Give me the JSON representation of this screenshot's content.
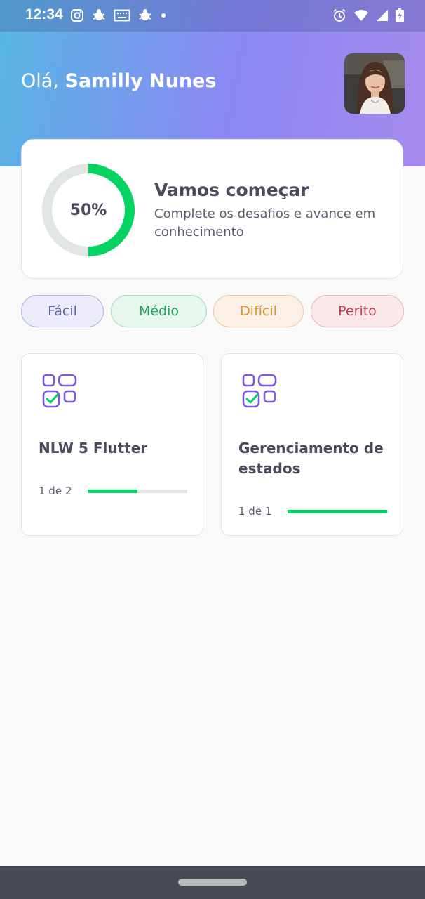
{
  "status_bar": {
    "time": "12:34",
    "left_icons": [
      "instagram-icon",
      "bug-icon",
      "keyboard-icon",
      "bug-icon",
      "dot-icon"
    ],
    "right_icons": [
      "alarm-icon",
      "wifi-icon",
      "signal-icon",
      "battery-charging-icon"
    ]
  },
  "header": {
    "greeting_prefix": "Olá, ",
    "user_name": "Samilly Nunes",
    "gradient_colors": [
      "#57B6E5",
      "#A68AED"
    ]
  },
  "score_card": {
    "percent": 50,
    "percent_label": "50%",
    "title": "Vamos começar",
    "subtitle": "Complete os desafios e avance em conhecimento",
    "ring_color": "#04D361",
    "ring_track_color": "#E1E6E3"
  },
  "levels": [
    {
      "label": "Fácil"
    },
    {
      "label": "Médio"
    },
    {
      "label": "Difícil"
    },
    {
      "label": "Perito"
    }
  ],
  "quizzes": [
    {
      "title": "NLW 5 Flutter",
      "progress_text": "1 de 2",
      "progress": 0.5
    },
    {
      "title": "Gerenciamento de estados",
      "progress_text": "1 de 1",
      "progress": 1.0
    }
  ],
  "colors": {
    "accent_green": "#04D361",
    "icon_purple": "#8257E5",
    "text_dark": "#4A4A5E"
  }
}
